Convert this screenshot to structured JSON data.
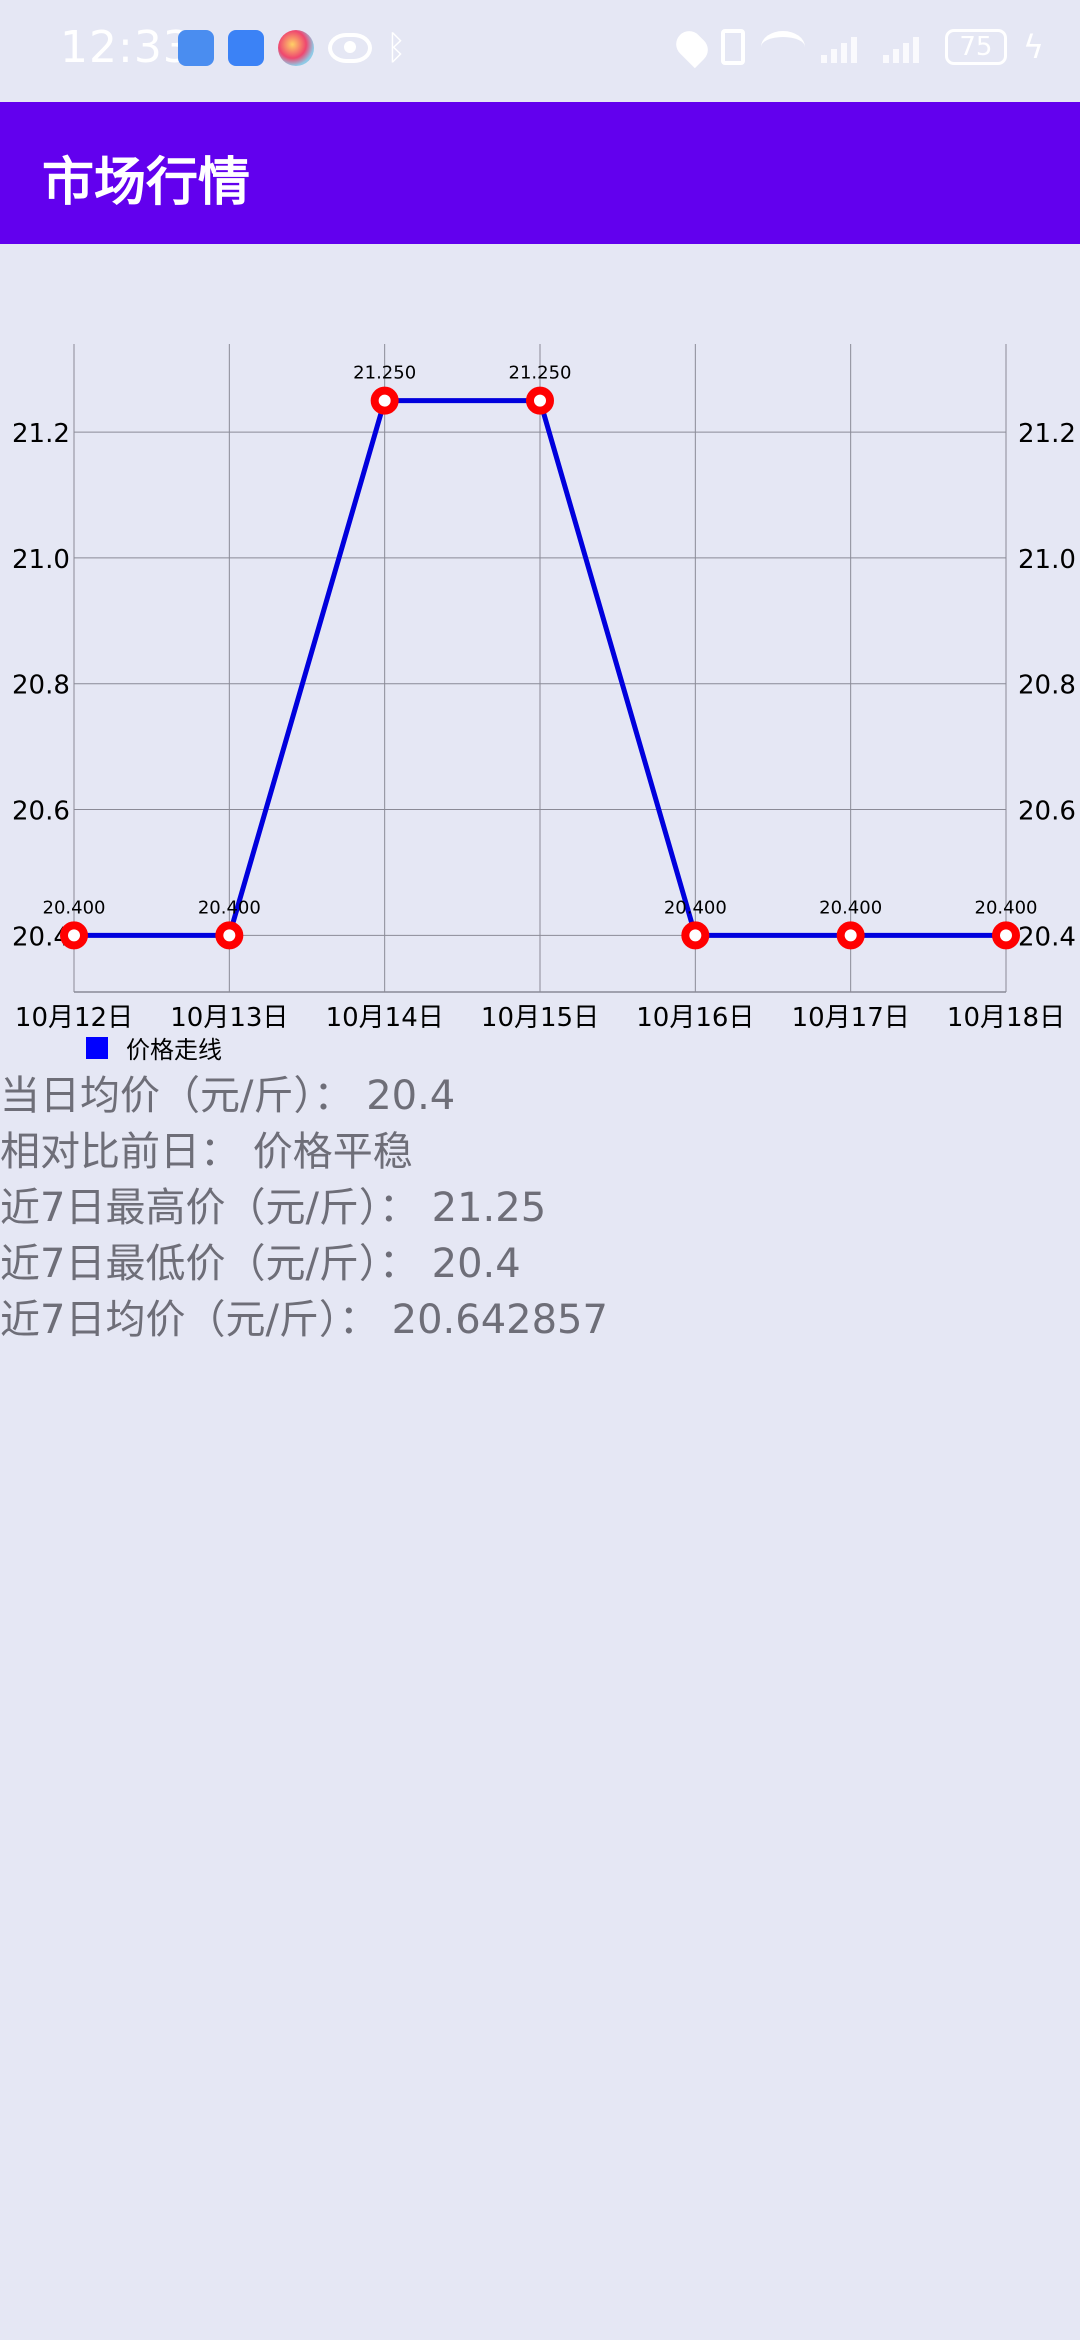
{
  "status_bar": {
    "time": "12:33",
    "battery": "75",
    "icons_left": [
      "usb-icon",
      "wallet-icon",
      "color-icon",
      "eye-icon",
      "bluetooth-icon"
    ],
    "icons_right": [
      "location-icon",
      "vibrate-icon",
      "wifi-icon",
      "signal-icon",
      "signal-icon",
      "battery-icon",
      "charging-icon"
    ]
  },
  "app_bar": {
    "title": "市场行情",
    "color": "#6200ee"
  },
  "chart_data": {
    "type": "line",
    "categories": [
      "10月12日",
      "10月13日",
      "10月14日",
      "10月15日",
      "10月16日",
      "10月17日",
      "10月18日"
    ],
    "series": [
      {
        "name": "价格走线",
        "values": [
          20.4,
          20.4,
          21.25,
          21.25,
          20.4,
          20.4,
          20.4
        ],
        "value_labels": [
          "20.400",
          "20.400",
          "21.250",
          "21.250",
          "20.400",
          "20.400",
          "20.400"
        ],
        "line_color": "#0000dd",
        "marker_color": "#ff0000"
      }
    ],
    "ylim": [
      20.31,
      21.34
    ],
    "yticks": [
      20.4,
      20.6,
      20.8,
      21.0,
      21.2
    ],
    "ytick_labels": [
      "20.4",
      "20.6",
      "20.8",
      "21.0",
      "21.2"
    ],
    "right_axis": true,
    "grid": true,
    "legend": "bottom-left"
  },
  "info": {
    "lines": [
      "当日均价（元/斤）：  20.4",
      "相对比前日：  价格平稳",
      "近7日最高价（元/斤）：  21.25",
      "近7日最低价（元/斤）：  20.4",
      "近7日均价（元/斤）：  20.642857"
    ]
  }
}
